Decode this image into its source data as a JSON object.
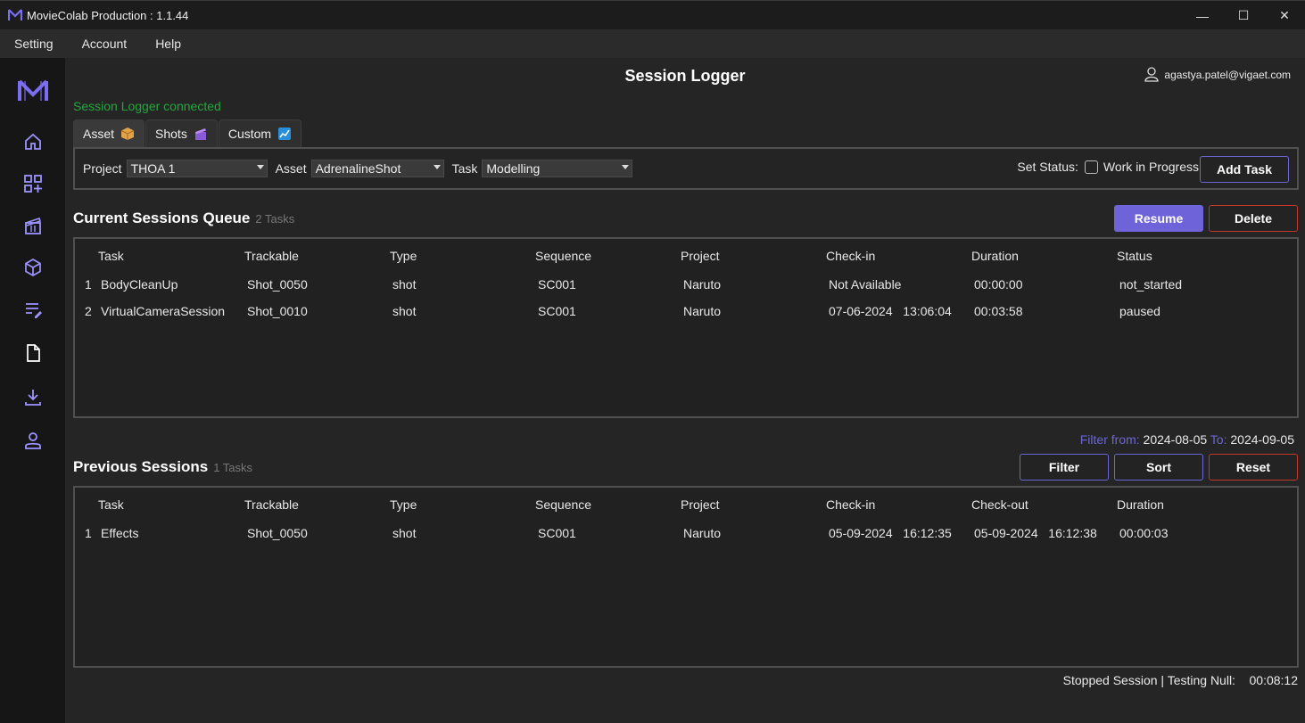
{
  "window": {
    "title": "MovieColab Production : 1.1.44",
    "minimize": "—",
    "maximize": "☐",
    "close": "✕"
  },
  "menu": [
    "Setting",
    "Account",
    "Help"
  ],
  "header": {
    "title": "Session Logger",
    "user": "agastya.patel@vigaet.com"
  },
  "status": {
    "connected": "Session Logger connected"
  },
  "tabs": [
    {
      "label": "Asset"
    },
    {
      "label": "Shots"
    },
    {
      "label": "Custom"
    }
  ],
  "filters": {
    "project_label": "Project",
    "project_value": "THOA 1",
    "asset_label": "Asset",
    "asset_value": "AdrenalineShot",
    "task_label": "Task",
    "task_value": "Modelling",
    "set_status_label": "Set Status:",
    "status_option": "Work in Progress",
    "add_task": "Add Task"
  },
  "queue": {
    "title": "Current Sessions Queue",
    "count": "2 Tasks",
    "resume": "Resume",
    "delete": "Delete",
    "columns": [
      "Task",
      "Trackable",
      "Type",
      "Sequence",
      "Project",
      "Check-in",
      "Duration",
      "Status"
    ],
    "rows": [
      [
        "1",
        "BodyCleanUp",
        "Shot_0050",
        "shot",
        "SC001",
        "Naruto",
        "Not Available",
        "00:00:00",
        "not_started"
      ],
      [
        "2",
        "VirtualCameraSession",
        "Shot_0010",
        "shot",
        "SC001",
        "Naruto",
        "07-06-2024   13:06:04",
        "00:03:58",
        "paused"
      ]
    ]
  },
  "filter_range": {
    "from_label": "Filter from:",
    "from": "2024-08-05",
    "to_label": "To:",
    "to": "2024-09-05"
  },
  "previous": {
    "title": "Previous Sessions",
    "count": "1 Tasks",
    "filter": "Filter",
    "sort": "Sort",
    "reset": "Reset",
    "columns": [
      "Task",
      "Trackable",
      "Type",
      "Sequence",
      "Project",
      "Check-in",
      "Check-out",
      "Duration"
    ],
    "rows": [
      [
        "1",
        "Effects",
        "Shot_0050",
        "shot",
        "SC001",
        "Naruto",
        "05-09-2024   16:12:35",
        "05-09-2024   16:12:38",
        "00:00:03"
      ]
    ]
  },
  "footer": {
    "text": "Stopped Session | Testing Null:    00:08:12"
  },
  "sidebar_icons": [
    "home-icon",
    "apps-add-icon",
    "clapperboard-icon",
    "cube-icon",
    "notes-icon",
    "document-icon",
    "download-icon",
    "person-icon"
  ],
  "colors": {
    "accent": "#6e63d9",
    "danger": "#c0392b",
    "connected": "#22a83a"
  }
}
